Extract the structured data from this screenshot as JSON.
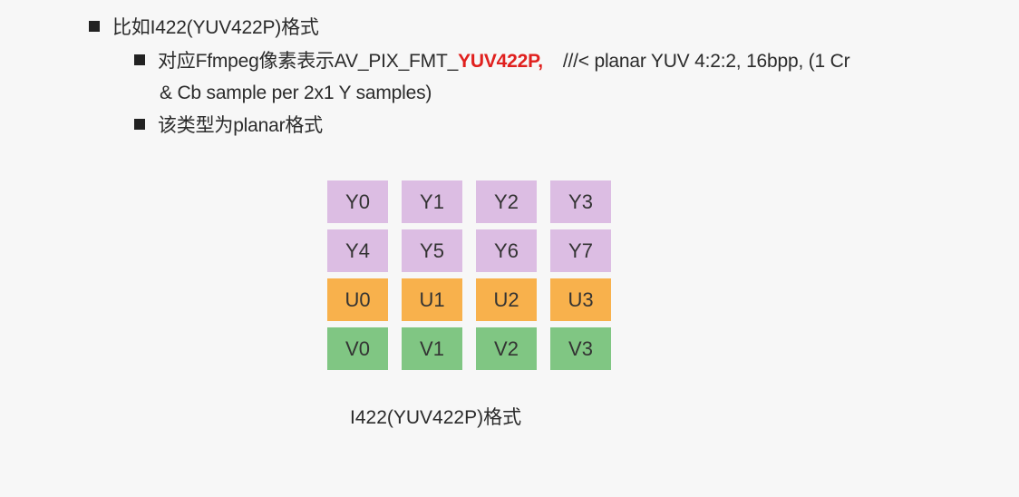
{
  "bullets": {
    "level1": "比如I422(YUV422P)格式",
    "level2_prefix": "对应Ffmpeg像素表示AV_PIX_FMT_",
    "level2_highlight": "YUV422P,",
    "level2_suffix": "///< planar YUV 4:2:2, 16bpp, (1 Cr",
    "level2_continuation": "& Cb sample per 2x1 Y samples)",
    "level3": "该类型为planar格式"
  },
  "colors": {
    "highlight": "#e0201e",
    "y_plane": "#dcbde3",
    "u_plane": "#f8b14c",
    "v_plane": "#80c683"
  },
  "grid": {
    "rows": [
      {
        "plane": "y",
        "cells": [
          "Y0",
          "Y1",
          "Y2",
          "Y3"
        ]
      },
      {
        "plane": "y",
        "cells": [
          "Y4",
          "Y5",
          "Y6",
          "Y7"
        ]
      },
      {
        "plane": "u",
        "cells": [
          "U0",
          "U1",
          "U2",
          "U3"
        ]
      },
      {
        "plane": "v",
        "cells": [
          "V0",
          "V1",
          "V2",
          "V3"
        ]
      }
    ]
  },
  "caption": "I422(YUV422P)格式"
}
